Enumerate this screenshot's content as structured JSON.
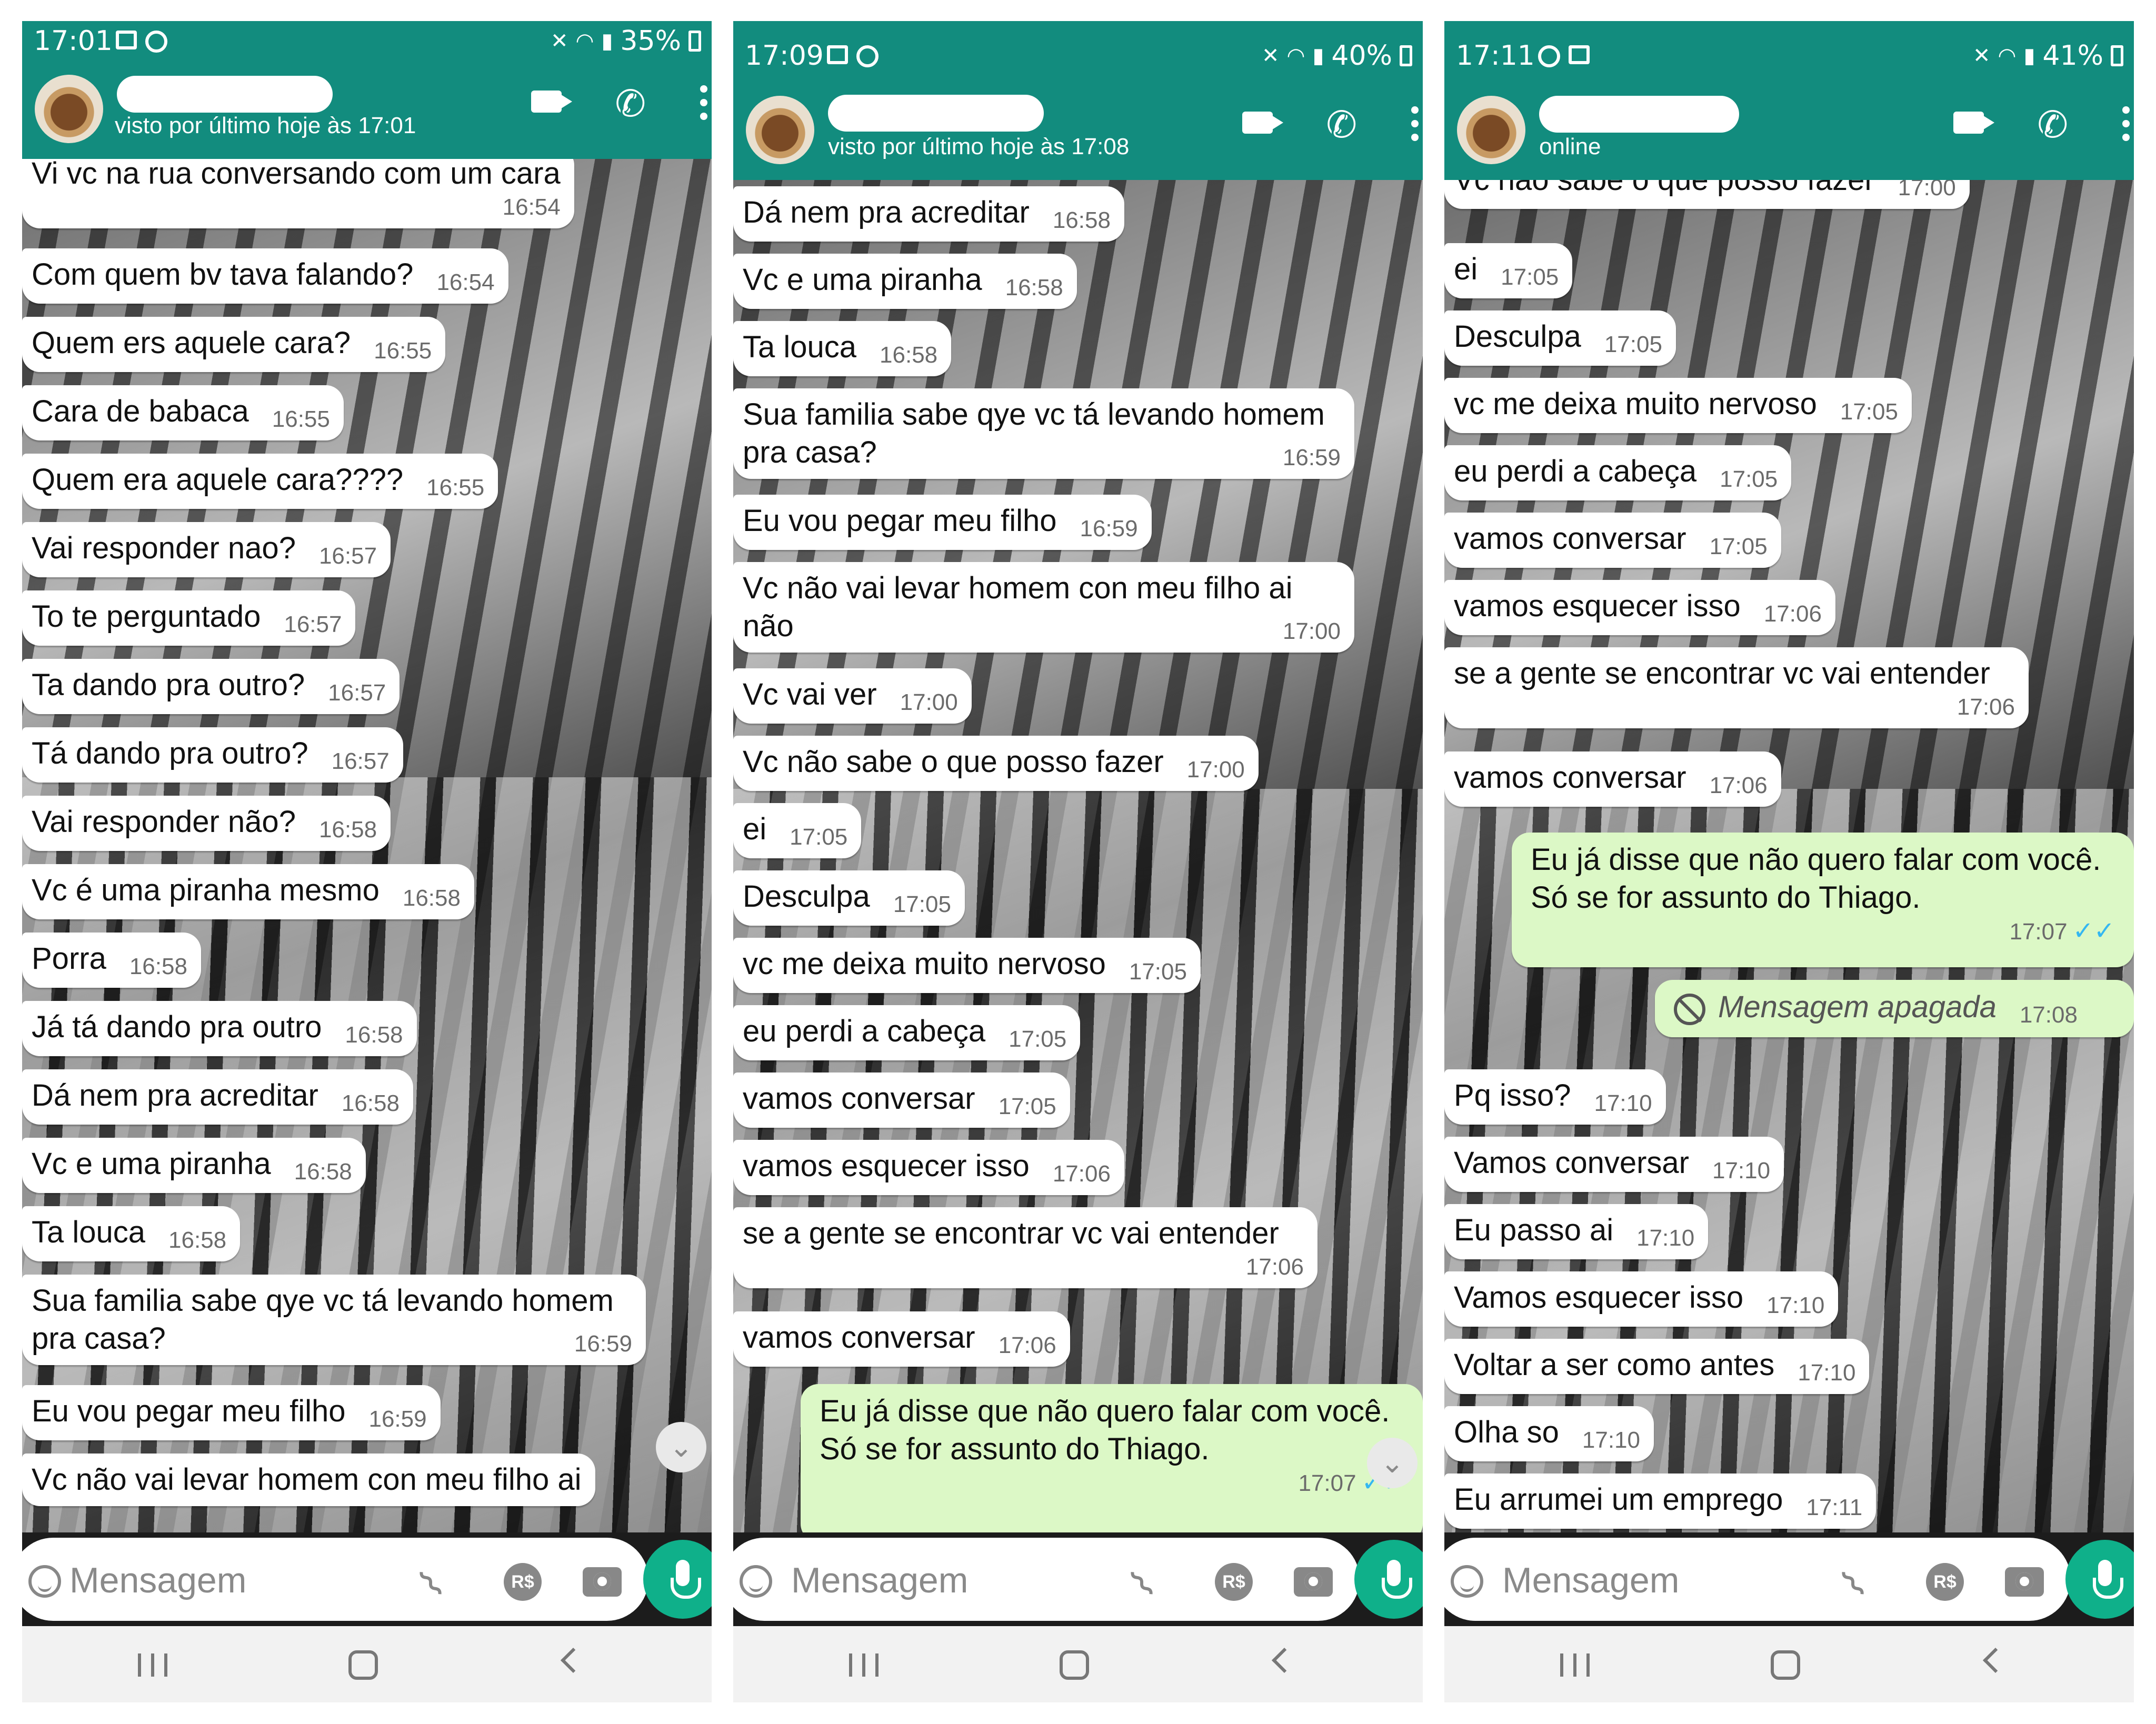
{
  "panels": [
    {
      "status": {
        "time": "17:01",
        "battery": "35%"
      },
      "header": {
        "subtitle": "visto por último hoje às 17:01"
      },
      "input": {
        "placeholder": "Mensagem"
      },
      "messages": [
        {
          "text": "Vi vc na rua conversando com um cara",
          "time": "16:54"
        },
        {
          "text": "Com quem bv tava falando?",
          "time": "16:54"
        },
        {
          "text": "Quem ers aquele cara?",
          "time": "16:55"
        },
        {
          "text": "Cara de babaca",
          "time": "16:55"
        },
        {
          "text": "Quem era aquele cara????",
          "time": "16:55"
        },
        {
          "text": "Vai responder nao?",
          "time": "16:57"
        },
        {
          "text": "To te perguntado",
          "time": "16:57"
        },
        {
          "text": "Ta dando pra outro?",
          "time": "16:57"
        },
        {
          "text": "Tá dando pra outro?",
          "time": "16:57"
        },
        {
          "text": "Vai responder não?",
          "time": "16:58"
        },
        {
          "text": "Vc é uma piranha mesmo",
          "time": "16:58"
        },
        {
          "text": "Porra",
          "time": "16:58"
        },
        {
          "text": "Já tá dando pra outro",
          "time": "16:58"
        },
        {
          "text": "Dá nem pra acreditar",
          "time": "16:58"
        },
        {
          "text": "Vc e uma piranha",
          "time": "16:58"
        },
        {
          "text": "Ta louca",
          "time": "16:58"
        },
        {
          "text": "Sua familia sabe qye vc tá levando homem pra casa?",
          "time": "16:59"
        },
        {
          "text": "Eu vou pegar meu filho",
          "time": "16:59"
        },
        {
          "text": "Vc não vai levar homem con meu filho ai",
          "time": ""
        }
      ]
    },
    {
      "status": {
        "time": "17:09",
        "battery": "40%"
      },
      "header": {
        "subtitle": "visto por último hoje às 17:08"
      },
      "input": {
        "placeholder": "Mensagem"
      },
      "messages": [
        {
          "text": "Dá nem pra acreditar",
          "time": "16:58"
        },
        {
          "text": "Vc e uma piranha",
          "time": "16:58"
        },
        {
          "text": "Ta louca",
          "time": "16:58"
        },
        {
          "text": "Sua familia sabe qye vc tá levando homem pra casa?",
          "time": "16:59"
        },
        {
          "text": "Eu vou pegar meu filho",
          "time": "16:59"
        },
        {
          "text": "Vc não vai levar homem con meu filho ai não",
          "time": "17:00"
        },
        {
          "text": "Vc vai ver",
          "time": "17:00"
        },
        {
          "text": "Vc não sabe o que posso fazer",
          "time": "17:00"
        },
        {
          "text": "ei",
          "time": "17:05"
        },
        {
          "text": "Desculpa",
          "time": "17:05"
        },
        {
          "text": "vc me deixa muito nervoso",
          "time": "17:05"
        },
        {
          "text": "eu perdi a cabeça",
          "time": "17:05"
        },
        {
          "text": "vamos conversar",
          "time": "17:05"
        },
        {
          "text": "vamos esquecer isso",
          "time": "17:06"
        },
        {
          "text": "se a gente se encontrar vc vai entender",
          "time": "17:06"
        },
        {
          "text": "vamos conversar",
          "time": "17:06"
        }
      ],
      "outgoing": {
        "text": "Eu já disse que não quero falar com você. Só se for assunto do Thiago.",
        "time": "17:07"
      }
    },
    {
      "status": {
        "time": "17:11",
        "battery": "41%"
      },
      "header": {
        "subtitle": "online"
      },
      "input": {
        "placeholder": "Mensagem"
      },
      "top_partial": {
        "text": "Vc não sabe o que posso fazer",
        "time": "17:00"
      },
      "messages_before": [
        {
          "text": "ei",
          "time": "17:05"
        },
        {
          "text": "Desculpa",
          "time": "17:05"
        },
        {
          "text": "vc me deixa muito nervoso",
          "time": "17:05"
        },
        {
          "text": "eu perdi a cabeça",
          "time": "17:05"
        },
        {
          "text": "vamos conversar",
          "time": "17:05"
        },
        {
          "text": "vamos esquecer isso",
          "time": "17:06"
        },
        {
          "text": "se a gente se encontrar vc vai entender",
          "time": "17:06"
        },
        {
          "text": "vamos conversar",
          "time": "17:06"
        }
      ],
      "outgoing": {
        "text": "Eu já disse que não quero falar com você. Só se for assunto do Thiago.",
        "time": "17:07"
      },
      "deleted": {
        "text": "Mensagem apagada",
        "time": "17:08"
      },
      "messages_after": [
        {
          "text": "Pq isso?",
          "time": "17:10"
        },
        {
          "text": "Vamos conversar",
          "time": "17:10"
        },
        {
          "text": "Eu passo ai",
          "time": "17:10"
        },
        {
          "text": "Vamos esquecer isso",
          "time": "17:10"
        },
        {
          "text": "Voltar a ser como antes",
          "time": "17:10"
        },
        {
          "text": "Olha so",
          "time": "17:10"
        },
        {
          "text": "Eu arrumei um emprego",
          "time": "17:11"
        }
      ]
    }
  ],
  "shared": {
    "pix_label": "R$"
  },
  "colors": {
    "header": "#128c7e",
    "outgoing_bubble": "#dcf8c6",
    "incoming_bubble": "#ffffff",
    "mic": "#0fb08a",
    "read_ticks": "#34b7f1"
  },
  "icons": [
    "gallery-icon",
    "whatsapp-icon",
    "mute-icon",
    "wifi-icon",
    "signal-icon",
    "battery-icon",
    "video-call-icon",
    "voice-call-icon",
    "menu-icon",
    "emoji-icon",
    "attach-icon",
    "pix-icon",
    "camera-icon",
    "mic-icon",
    "scroll-down-icon",
    "deleted-icon"
  ]
}
